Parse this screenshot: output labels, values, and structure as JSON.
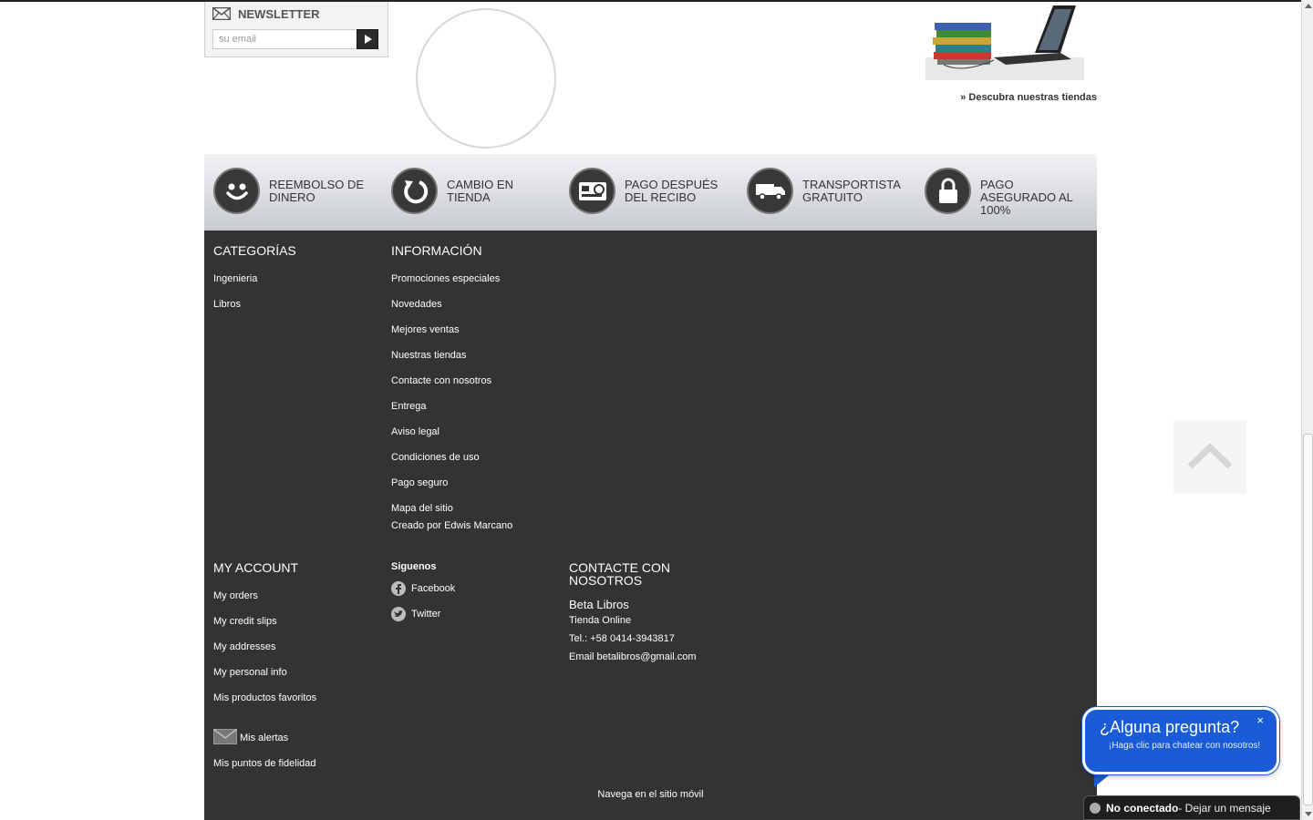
{
  "newsletter": {
    "title": "Newsletter",
    "email_placeholder": "su email"
  },
  "stores": {
    "link_label": "» Descubra nuestras tiendas"
  },
  "reassurance": {
    "items": [
      {
        "label": "Reembolso de dinero",
        "icon": "smile-icon"
      },
      {
        "label": "Cambio en tienda",
        "icon": "refresh-icon"
      },
      {
        "label": "Pago después del recibo",
        "icon": "card-icon"
      },
      {
        "label": "Transportista gratuito",
        "icon": "truck-icon"
      },
      {
        "label": "Pago asegurado al 100%",
        "icon": "lock-icon"
      }
    ]
  },
  "footer": {
    "categories": {
      "title": "Categorías",
      "items": [
        "Ingenieria",
        "Libros"
      ]
    },
    "information": {
      "title": "Información",
      "items": [
        "Promociones especiales",
        "Novedades",
        "Mejores ventas",
        "Nuestras tiendas",
        "Contacte con nosotros",
        "Entrega",
        "Aviso legal",
        "Condiciones de uso",
        "Pago seguro",
        "Mapa del sitio"
      ],
      "created_by": "Creado por Edwis Marcano"
    },
    "account": {
      "title": "My account",
      "items": [
        "My orders",
        "My credit slips",
        "My addresses",
        "My personal info",
        "Mis productos favoritos",
        "Mis alertas",
        "Mis puntos de fidelidad"
      ]
    },
    "social": {
      "title": "Siguenos",
      "items": [
        "Facebook",
        "Twitter"
      ]
    },
    "contact": {
      "title": "Contacte con nosotros",
      "name": "Beta Libros",
      "line1": "Tienda Online",
      "phone": "Tel.: +58 0414-3943817",
      "email": "Email betalibros@gmail.com"
    },
    "mobile_link": "Navega en el sitio móvil"
  },
  "chat": {
    "question": "¿Alguna pregunta?",
    "subtitle": "¡Haga clic para chatear con nosotros!",
    "close": "×",
    "status": "No conectado",
    "message": " - Dejar un mensaje"
  }
}
